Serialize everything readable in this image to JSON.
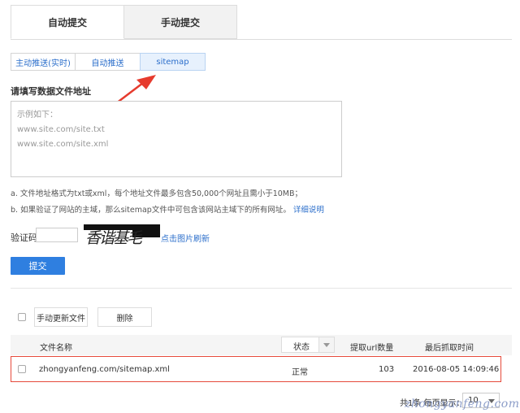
{
  "tabs": [
    {
      "label": "自动提交",
      "active": true
    },
    {
      "label": "手动提交",
      "active": false
    }
  ],
  "subtabs": [
    {
      "label": "主动推送(实时)"
    },
    {
      "label": "自动推送"
    },
    {
      "label": "sitemap",
      "active": true
    }
  ],
  "form": {
    "section_title": "请填写数据文件地址",
    "placeholder_lines": [
      "示例如下：",
      "www.site.com/site.txt",
      "www.site.com/site.xml"
    ],
    "note_a": "a. 文件地址格式为txt或xml，每个地址文件最多包含50,000个网址且需小于10MB；",
    "note_b": "b. 如果验证了网站的主域，那么sitemap文件中可包含该网站主域下的所有网址。",
    "note_b_link": "详细说明",
    "captcha_label": "验证码",
    "captcha_text": "香谐基毛",
    "refresh_link": "点击图片刷新",
    "submit_label": "提交"
  },
  "list": {
    "manual_update_label": "手动更新文件",
    "delete_label": "删除",
    "columns": {
      "file": "文件名称",
      "status": "状态",
      "url_count": "提取url数量",
      "last_fetch": "最后抓取时间"
    },
    "rows": [
      {
        "file": "zhongyanfeng.com/sitemap.xml",
        "status": "正常",
        "url_count": "103",
        "last_fetch": "2016-08-05 14:09:46"
      }
    ]
  },
  "pager": {
    "total_text": "共1条  每页显示：",
    "per_page": "10"
  },
  "watermark": "zhongyanfeng.com",
  "colors": {
    "accent": "#2f7fe0",
    "link": "#2c6fcb",
    "highlight_border": "#e64a3b",
    "arrow": "#e63b2e"
  }
}
